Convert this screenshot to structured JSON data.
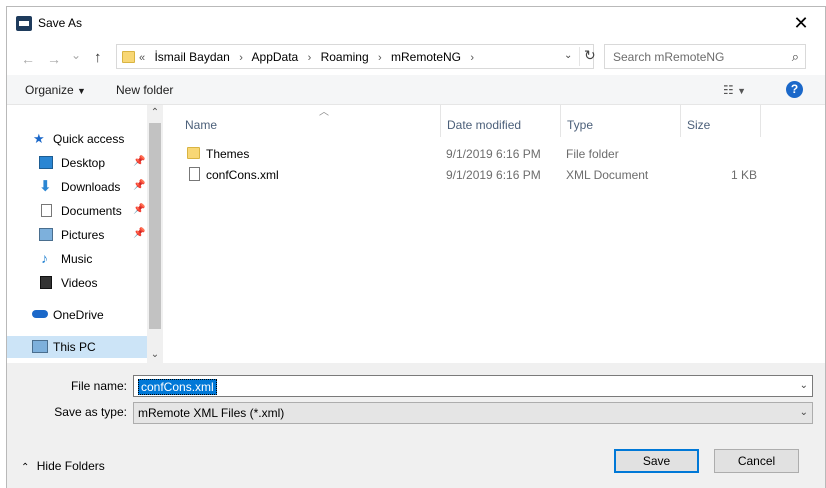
{
  "window": {
    "title": "Save As"
  },
  "nav_buttons": {
    "back": "←",
    "forward": "→",
    "up": "↑",
    "recent": "⌄"
  },
  "address": {
    "prefix": "«",
    "crumbs": [
      "İsmail Baydan",
      "AppData",
      "Roaming",
      "mRemoteNG"
    ],
    "separator": "›"
  },
  "search": {
    "placeholder": "Search mRemoteNG"
  },
  "toolbar": {
    "organize": "Organize",
    "new_folder": "New folder"
  },
  "sidebar": {
    "items": [
      {
        "label": "Quick access",
        "icon": "star-icon",
        "pinned": false
      },
      {
        "label": "Desktop",
        "icon": "desktop-icon",
        "pinned": true
      },
      {
        "label": "Downloads",
        "icon": "download-icon",
        "pinned": true
      },
      {
        "label": "Documents",
        "icon": "document-icon",
        "pinned": true
      },
      {
        "label": "Pictures",
        "icon": "picture-icon",
        "pinned": true
      },
      {
        "label": "Music",
        "icon": "music-icon",
        "pinned": false
      },
      {
        "label": "Videos",
        "icon": "video-icon",
        "pinned": false
      },
      {
        "label": "OneDrive",
        "icon": "cloud-icon",
        "pinned": false
      },
      {
        "label": "This PC",
        "icon": "computer-icon",
        "pinned": false,
        "selected": true
      }
    ]
  },
  "columns": [
    "Name",
    "Date modified",
    "Type",
    "Size"
  ],
  "files": [
    {
      "name": "Themes",
      "date": "9/1/2019 6:16 PM",
      "type": "File folder",
      "size": "",
      "icon": "folder-icon"
    },
    {
      "name": "confCons.xml",
      "date": "9/1/2019 6:16 PM",
      "type": "XML Document",
      "size": "1 KB",
      "icon": "xml-file-icon"
    }
  ],
  "form": {
    "file_name_label": "File name:",
    "file_name_value": "confCons.xml",
    "save_type_label": "Save as type:",
    "save_type_value": "mRemote XML Files (*.xml)"
  },
  "buttons": {
    "save": "Save",
    "cancel": "Cancel",
    "hide_folders": "Hide Folders"
  },
  "colors": {
    "accent": "#0078d7",
    "selection": "#cce4f7",
    "help": "#1b68c9",
    "folder": "#f8d775"
  }
}
